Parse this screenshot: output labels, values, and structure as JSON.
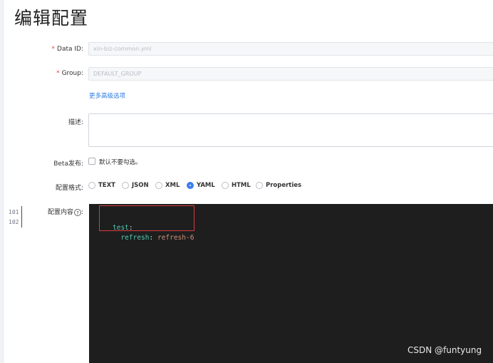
{
  "page": {
    "title": "编辑配置"
  },
  "form": {
    "data_id": {
      "label": "Data ID:",
      "value": "xin-biz-common.yml",
      "required": true
    },
    "group": {
      "label": "Group:",
      "value": "DEFAULT_GROUP",
      "required": true
    },
    "advanced_link": "更多高级选项",
    "description": {
      "label": "描述:",
      "value": ""
    },
    "beta": {
      "label": "Beta发布:",
      "checkbox_label": "默认不要勾选。",
      "checked": false
    },
    "format": {
      "label": "配置格式:",
      "options": [
        "TEXT",
        "JSON",
        "XML",
        "YAML",
        "HTML",
        "Properties"
      ],
      "selected": "YAML"
    },
    "content": {
      "label": "配置内容",
      "help_icon": "?"
    }
  },
  "editor": {
    "lines": [
      {
        "number": "101",
        "key": "test",
        "sep": ":",
        "value": ""
      },
      {
        "number": "102",
        "indent": "  ",
        "key": "refresh",
        "sep": ": ",
        "value": "refresh-6"
      }
    ]
  },
  "colors": {
    "accent": "#3a7ff0",
    "required": "#e04b3a",
    "editor_bg": "#1e1e1e",
    "highlight_border": "#d93a3a"
  },
  "watermark": "CSDN @funtyung"
}
